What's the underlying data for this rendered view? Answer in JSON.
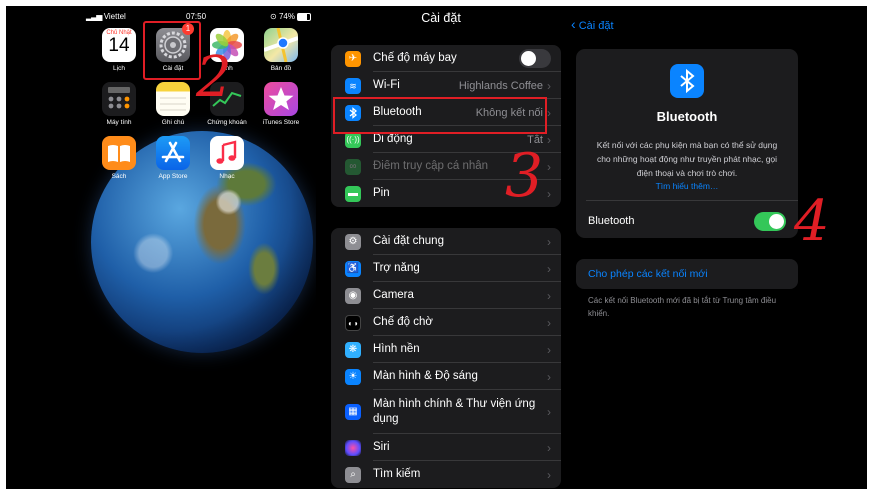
{
  "home": {
    "carrier": "Viettel",
    "time": "07:50",
    "battery": "74%",
    "badge": "1",
    "apps": [
      {
        "label": "Lịch",
        "month": "Chủ Nhật",
        "day": "14"
      },
      {
        "label": "Cài đặt"
      },
      {
        "label": "Ảnh"
      },
      {
        "label": "Bản đồ"
      },
      {
        "label": "Máy tính"
      },
      {
        "label": "Ghi chú"
      },
      {
        "label": "Chứng khoán"
      },
      {
        "label": "iTunes Store"
      },
      {
        "label": "Sách"
      },
      {
        "label": "App Store"
      },
      {
        "label": "Nhạc"
      }
    ]
  },
  "annotations": {
    "step2": "2",
    "step3": "3",
    "step4": "4"
  },
  "settings": {
    "title": "Cài đặt",
    "group1": [
      {
        "label": "Chế độ máy bay",
        "value": "",
        "icon": "airplane-icon",
        "color": "#ff9500"
      },
      {
        "label": "Wi-Fi",
        "value": "Highlands Coffee",
        "icon": "wifi-icon",
        "color": "#0a84ff"
      },
      {
        "label": "Bluetooth",
        "value": "Không kết nối",
        "icon": "bluetooth-icon",
        "color": "#0a84ff"
      },
      {
        "label": "Di động",
        "value": "Tắt",
        "icon": "cellular-icon",
        "color": "#34c759"
      },
      {
        "label": "Điểm truy cập cá nhân",
        "value": "",
        "icon": "hotspot-icon",
        "color": "#34c759"
      },
      {
        "label": "Pin",
        "value": "",
        "icon": "battery-icon",
        "color": "#34c759"
      }
    ],
    "group2": [
      {
        "label": "Cài đặt chung",
        "icon": "gear-icon",
        "color": "#8e8e93"
      },
      {
        "label": "Trợ năng",
        "icon": "accessibility-icon",
        "color": "#0a84ff"
      },
      {
        "label": "Camera",
        "icon": "camera-icon",
        "color": "#8e8e93"
      },
      {
        "label": "Chế độ chờ",
        "icon": "standby-icon",
        "color": "#1c1c1e"
      },
      {
        "label": "Hình nền",
        "icon": "wallpaper-icon",
        "color": "#30b0ff"
      },
      {
        "label": "Màn hình & Độ sáng",
        "icon": "brightness-icon",
        "color": "#0a84ff"
      },
      {
        "label": "Màn hình chính & Thư viện ứng dụng",
        "icon": "homescreen-icon",
        "color": "#0a60ff"
      },
      {
        "label": "Siri",
        "icon": "siri-icon",
        "color": "#222"
      },
      {
        "label": "Tìm kiếm",
        "icon": "search-icon",
        "color": "#8e8e93"
      }
    ]
  },
  "bluetooth": {
    "back": "Cài đặt",
    "title": "Bluetooth",
    "description": "Kết nối với các phụ kiện mà bạn có thể sử dụng cho những hoạt động như truyền phát nhạc, gọi điện thoại và chơi trò chơi.",
    "learn_more": "Tìm hiểu thêm…",
    "toggle_label": "Bluetooth",
    "toggle_on": true,
    "allow_new": "Cho phép các kết nối mới",
    "footer": "Các kết nối Bluetooth mới đã bị tắt từ Trung tâm điều khiển."
  }
}
